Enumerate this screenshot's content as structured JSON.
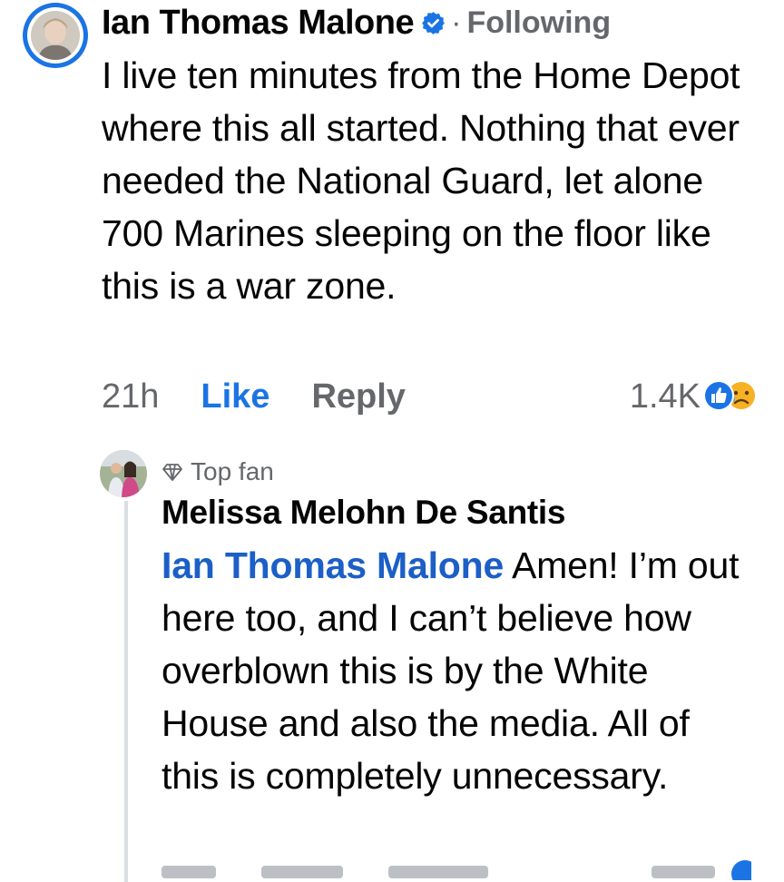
{
  "comment": {
    "author": "Ian Thomas Malone",
    "separator": "·",
    "following": "Following",
    "text": "I live ten minutes from the Home Depot where this all started. Nothing that ever needed the National Guard, let alone 700 Marines sleeping on the floor like this is a war zone.",
    "time": "21h",
    "like_label": "Like",
    "reply_label": "Reply",
    "reaction_count": "1.4K",
    "reactions": [
      "like-icon",
      "sad-icon"
    ]
  },
  "reply": {
    "badge": "Top fan",
    "author": "Melissa Melohn De Santis",
    "mention": "Ian Thomas Malone",
    "text": " Amen! I’m out here too, and I can’t believe how overblown this is by the White House and also the media. All of this is completely unnecessary."
  },
  "colors": {
    "accent": "#1b74e4",
    "mention": "#1b5fc7",
    "secondary_text": "#65676b"
  }
}
